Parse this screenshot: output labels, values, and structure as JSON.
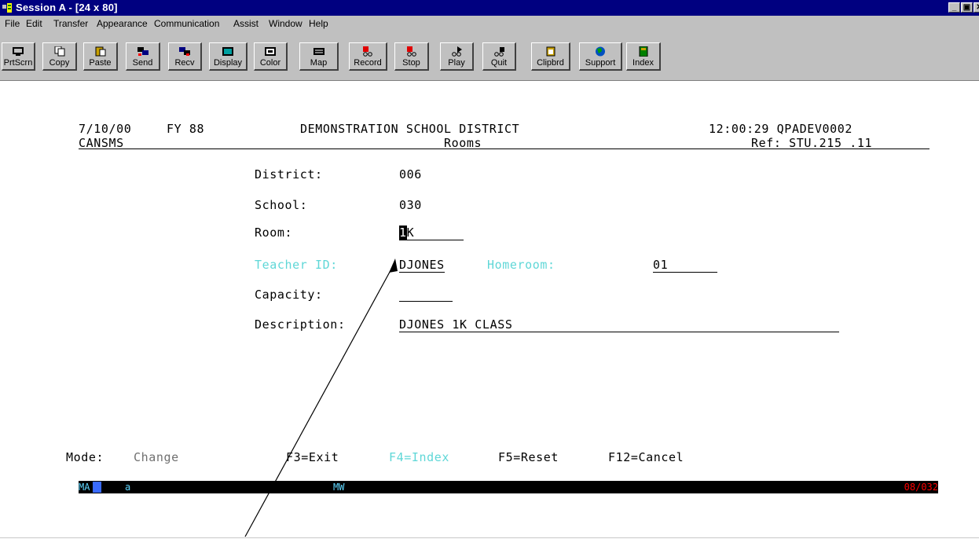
{
  "window": {
    "title": "Session A - [24 x 80]"
  },
  "menu": [
    {
      "label": "File"
    },
    {
      "label": "Edit"
    },
    {
      "label": "Transfer"
    },
    {
      "label": "Appearance"
    },
    {
      "label": "Communication"
    },
    {
      "label": "Assist"
    },
    {
      "label": "Window"
    },
    {
      "label": "Help"
    }
  ],
  "toolbar": [
    {
      "label": "PrtScrn",
      "icon": "printer-screen-icon"
    },
    {
      "label": "Copy",
      "icon": "copy-icon"
    },
    {
      "label": "Paste",
      "icon": "paste-icon"
    },
    {
      "label": "Send",
      "icon": "send-icon"
    },
    {
      "label": "Recv",
      "icon": "receive-icon"
    },
    {
      "label": "Display",
      "icon": "display-icon"
    },
    {
      "label": "Color",
      "icon": "color-icon"
    },
    {
      "label": "Map",
      "icon": "keyboard-map-icon"
    },
    {
      "label": "Record",
      "icon": "record-icon"
    },
    {
      "label": "Stop",
      "icon": "stop-icon"
    },
    {
      "label": "Play",
      "icon": "play-icon"
    },
    {
      "label": "Quit",
      "icon": "quit-icon"
    },
    {
      "label": "Clipbrd",
      "icon": "clipboard-icon"
    },
    {
      "label": "Support",
      "icon": "globe-icon"
    },
    {
      "label": "Index",
      "icon": "book-icon"
    }
  ],
  "screen": {
    "date": "7/10/00",
    "fy": "FY 88",
    "district_name": "DEMONSTRATION SCHOOL DISTRICT",
    "time_id": "12:00:29 QPADEV0002",
    "program": "CANSMS",
    "subtitle": "Rooms",
    "ref": "Ref: STU.215 .11",
    "fields": {
      "district_label": "District:",
      "district_value": "006",
      "school_label": "School:",
      "school_value": "030",
      "room_label": "Room:",
      "room_cursor_char": "1",
      "room_value_rest": "K",
      "teacher_label": "Teacher ID:",
      "teacher_value": "DJONES",
      "homeroom_label": "Homeroom:",
      "homeroom_value": "01",
      "capacity_label": "Capacity:",
      "capacity_value": "",
      "description_label": "Description:",
      "description_value": "DJONES 1K CLASS"
    },
    "mode_label": "Mode:",
    "mode_value": "Change",
    "fkeys": {
      "f3": "F3=Exit",
      "f4": "F4=Index",
      "f5": "F5=Reset",
      "f12": "F12=Cancel"
    }
  },
  "statusbar": {
    "ma": "MA",
    "a": "a",
    "mw": "MW",
    "cursor_pos": "08/032"
  },
  "colors": {
    "titlebar": "#000080",
    "chrome": "#c0c0c0",
    "cyan_field": "#5fd7d7",
    "status_pos": "#ff0000"
  }
}
